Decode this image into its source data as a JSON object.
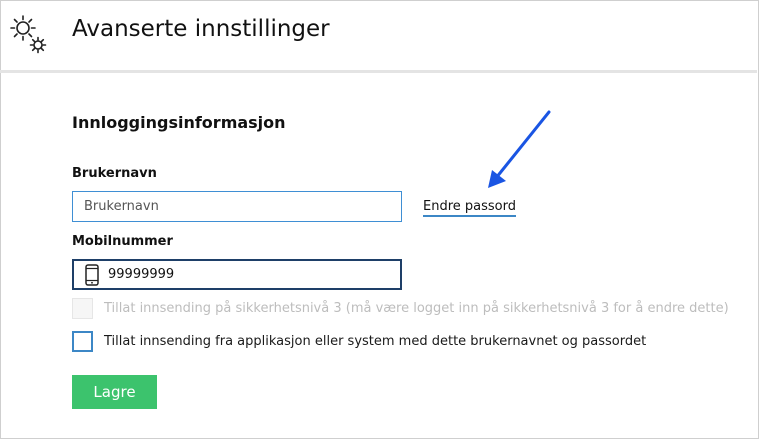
{
  "header": {
    "title": "Avanserte innstillinger",
    "icon": "gears-icon"
  },
  "section": {
    "title": "Innloggingsinformasjon"
  },
  "username": {
    "label": "Brukernavn",
    "placeholder": "Brukernavn",
    "value": ""
  },
  "change_password": {
    "label": "Endre passord"
  },
  "mobile": {
    "label": "Mobilnummer",
    "value": "99999999",
    "icon": "mobile-phone-icon"
  },
  "checkboxes": [
    {
      "label": "Tillat innsending på sikkerhetsnivå 3 (må være logget inn på sikkerhetsnivå 3 for å endre dette)",
      "checked": false,
      "disabled": true
    },
    {
      "label": "Tillat innsending fra applikasjon eller system med dette brukernavnet og passordet",
      "checked": false,
      "disabled": false
    }
  ],
  "save_button": {
    "label": "Lagre"
  },
  "annotation": {
    "arrow_color": "#1a55e3"
  },
  "colors": {
    "primary_blue": "#3c87c6",
    "save_green": "#3cc36d",
    "phone_border": "#1e3f68"
  }
}
